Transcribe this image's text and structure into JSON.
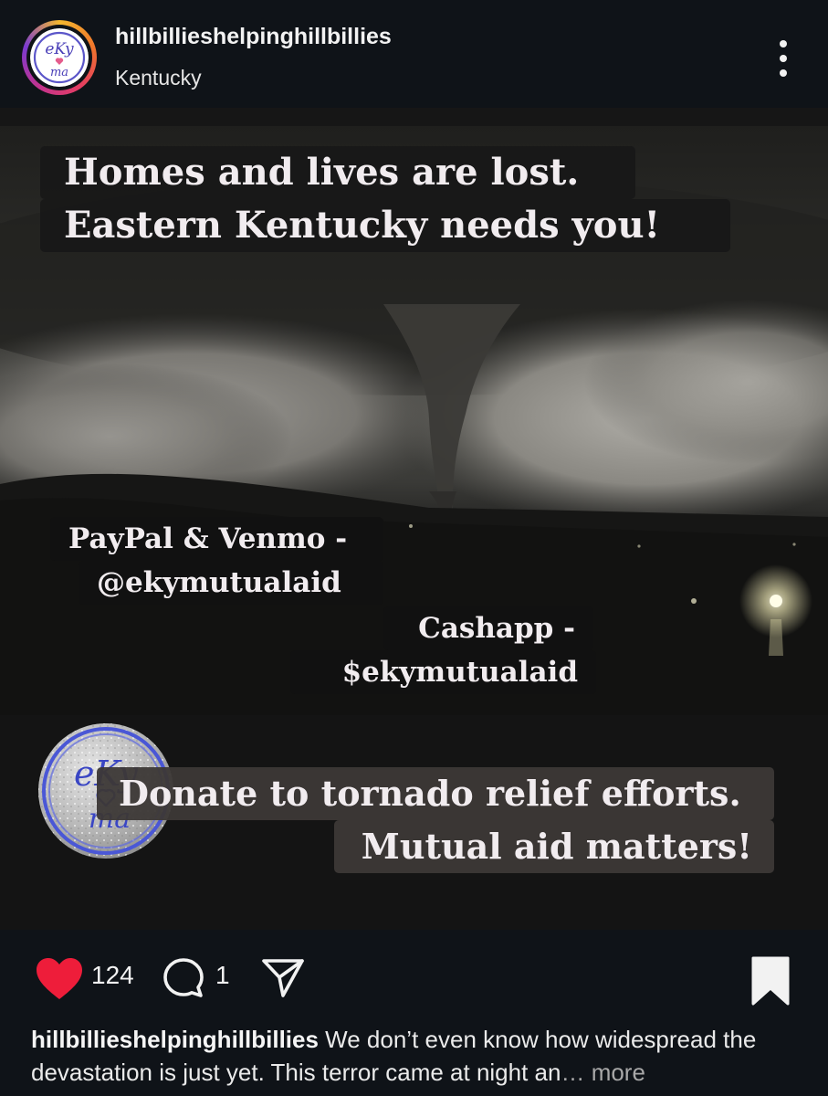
{
  "post": {
    "username": "hillbillieshelpinghillbillies",
    "location": "Kentucky",
    "avatar_text_top": "eKy",
    "avatar_text_bottom": "ma"
  },
  "image": {
    "headline": [
      "Homes and lives are lost.",
      "Eastern Kentucky needs you!"
    ],
    "paypal": [
      "PayPal & Venmo -",
      "@ekymutualaid"
    ],
    "cashapp": [
      "Cashapp -",
      "$ekymutualaid"
    ],
    "cta": [
      "Donate to tornado relief efforts.",
      "Mutual aid matters!"
    ],
    "sticker_top": "eKy",
    "sticker_bottom": "ma"
  },
  "actions": {
    "likes": "124",
    "comments": "1",
    "liked": true,
    "heart_color": "#ee1d3a"
  },
  "caption": {
    "username": "hillbillieshelpinghillbillies",
    "text": " We don’t even know how widespread the devastation is just yet. This terror came at night an",
    "more": "… more"
  },
  "icons": {
    "menu": "more-vertical-icon",
    "like": "heart-icon",
    "comment": "comment-icon",
    "share": "share-icon",
    "save": "bookmark-icon"
  }
}
